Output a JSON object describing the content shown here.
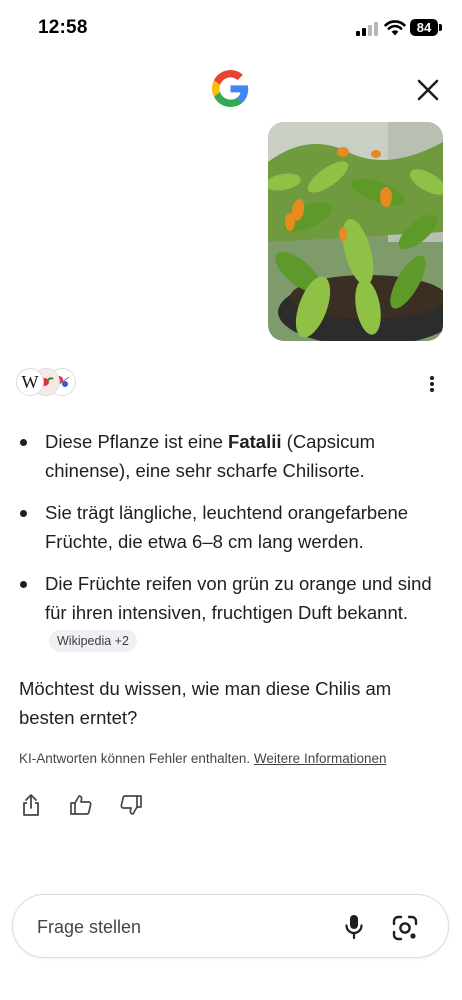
{
  "status_bar": {
    "time": "12:58",
    "battery": "84",
    "icons": [
      "signal-icon",
      "wifi-icon",
      "battery-icon"
    ]
  },
  "header": {
    "logo": "google-logo",
    "close_icon": "close-icon"
  },
  "sources": {
    "icons": [
      "wikipedia-icon",
      "source-icon",
      "source-icon"
    ]
  },
  "answer": {
    "bullets": [
      {
        "parts": [
          "Diese Pflanze ist eine ",
          "Fatalii",
          " (Capsicum chinense), eine sehr scharfe Chilisorte."
        ]
      },
      {
        "text": "Sie trägt längliche, leuchtend orangefarbene Früchte, die etwa 6–8 cm lang werden."
      },
      {
        "text": "Die Früchte reifen von grün zu orange und sind für ihren intensiven, fruchtigen Duft bekannt.",
        "chip": "Wikipedia +2"
      }
    ],
    "followup": "Möchtest du wissen, wie man diese Chilis am besten erntet?",
    "disclaimer": "KI-Antworten können Fehler enthalten.",
    "disclaimer_link": "Weitere Informationen"
  },
  "feedback": {
    "icons": [
      "share-icon",
      "thumbs-up-icon",
      "thumbs-down-icon"
    ]
  },
  "input": {
    "placeholder": "Frage stellen",
    "value": "",
    "icons": [
      "microphone-icon",
      "google-lens-icon"
    ]
  },
  "colors": {
    "google_blue": "#4285F4",
    "google_red": "#EA4335",
    "google_yellow": "#FBBC05",
    "google_green": "#34A853",
    "text": "#1f1f1f",
    "chip_bg": "#eef0f3"
  }
}
